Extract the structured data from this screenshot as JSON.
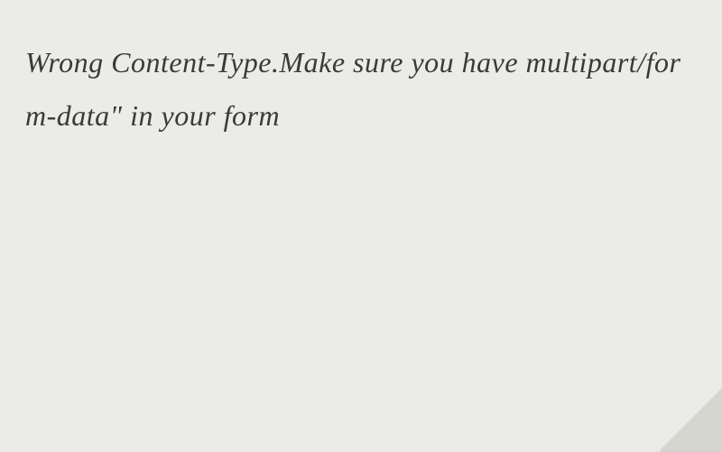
{
  "text": "Wrong Content-Type.Make sure you have multipart/form-data\" in your form"
}
